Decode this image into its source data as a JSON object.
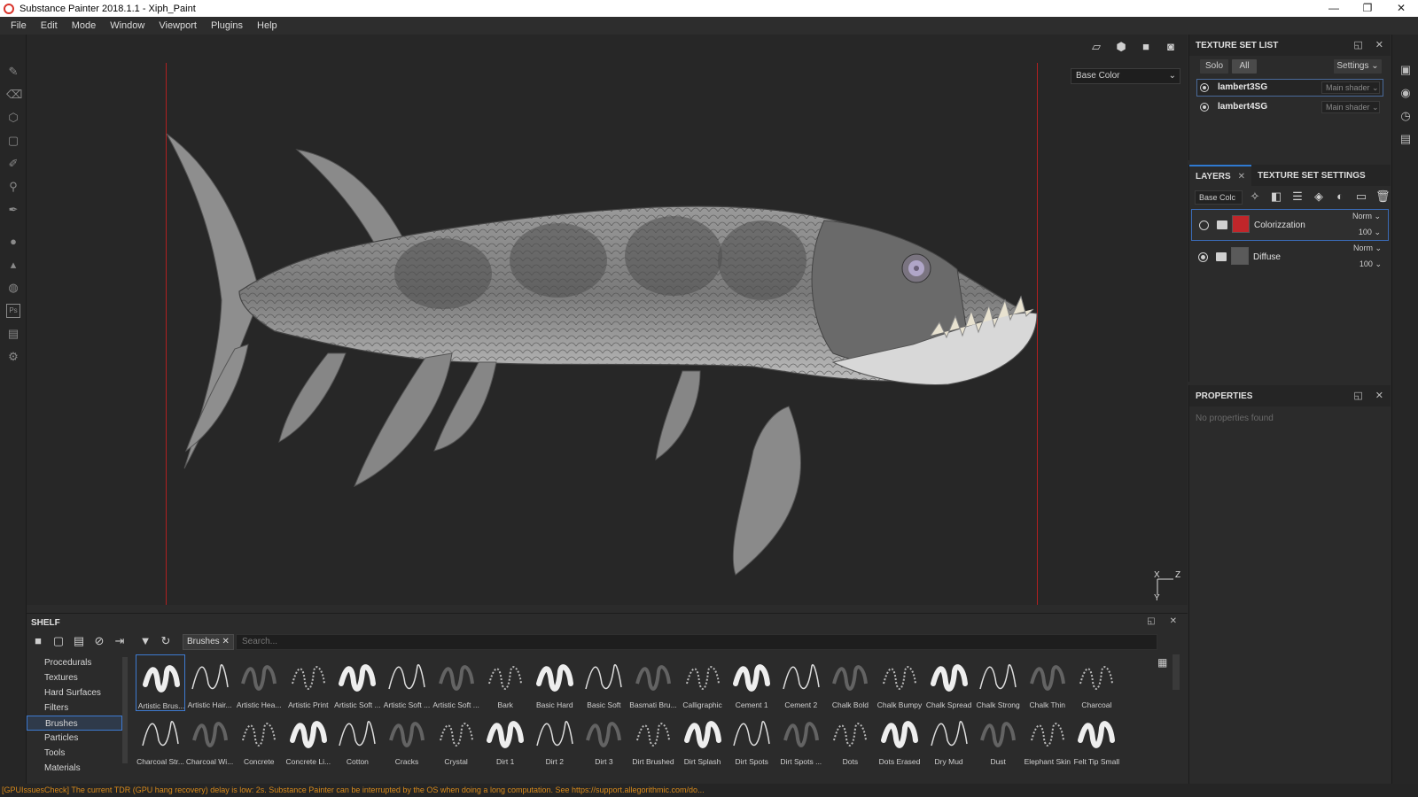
{
  "window": {
    "title": "Substance Painter 2018.1.1 - Xiph_Paint",
    "controls": [
      "—",
      "❐",
      "✕"
    ]
  },
  "menu": [
    "File",
    "Edit",
    "Mode",
    "Window",
    "Viewport",
    "Plugins",
    "Help"
  ],
  "left_tools": [
    "paint-brush-icon",
    "eraser-icon",
    "projection-icon",
    "geometry-mask-icon",
    "smudge-icon",
    "clone-icon",
    "color-picker-icon",
    "material-ball-icon",
    "bell-icon",
    "sphere-icon",
    "photoshop-icon",
    "export-icon",
    "settings-icon"
  ],
  "viewport": {
    "channel": "Base Color",
    "toolbar_icons": [
      "frame-icon",
      "cube-icon",
      "camera-icon",
      "screenshot-icon"
    ],
    "axis": {
      "x": "X",
      "z": "Z",
      "y": "Y"
    }
  },
  "texture_set_list": {
    "header": "TEXTURE SET LIST",
    "solo_label": "Solo",
    "all_label": "All",
    "settings_label": "Settings",
    "sets": [
      {
        "name": "lambert3SG",
        "shader": "Main shader",
        "active": true
      },
      {
        "name": "lambert4SG",
        "shader": "Main shader",
        "active": false
      }
    ]
  },
  "layers_panel": {
    "tab_layers": "LAYERS",
    "tab_settings": "TEXTURE SET SETTINGS",
    "channel": "Base Colc",
    "layers": [
      {
        "name": "Colorizzation",
        "blend": "Norm",
        "opacity": "100",
        "visible": false,
        "active": true,
        "thumb_color": "#c0262a"
      },
      {
        "name": "Diffuse",
        "blend": "Norm",
        "opacity": "100",
        "visible": true,
        "active": false,
        "thumb_color": "#5a5a5a"
      }
    ]
  },
  "properties": {
    "header": "PROPERTIES",
    "empty_text": "No properties found"
  },
  "shelf": {
    "header": "SHELF",
    "filter_chip": "Brushes",
    "search_placeholder": "Search...",
    "categories": [
      "Procedurals",
      "Textures",
      "Hard Surfaces",
      "Filters",
      "Brushes",
      "Particles",
      "Tools",
      "Materials"
    ],
    "active_category": "Brushes",
    "items_row1": [
      "Artistic Brus...",
      "Artistic Hair...",
      "Artistic Hea...",
      "Artistic Print",
      "Artistic Soft ...",
      "Artistic Soft ...",
      "Artistic Soft ...",
      "Bark",
      "Basic Hard",
      "Basic Soft",
      "Basmati Bru...",
      "Calligraphic",
      "Cement 1",
      "Cement 2",
      "Chalk Bold",
      "Chalk Bumpy",
      "Chalk Spread",
      "Chalk Strong",
      "Chalk Thin",
      "Charcoal"
    ],
    "items_row2": [
      "Charcoal Str...",
      "Charcoal Wi...",
      "Concrete",
      "Concrete Li...",
      "Cotton",
      "Cracks",
      "Crystal",
      "Dirt 1",
      "Dirt 2",
      "Dirt 3",
      "Dirt Brushed",
      "Dirt Splash",
      "Dirt Spots",
      "Dirt Spots ...",
      "Dots",
      "Dots Erased",
      "Dry Mud",
      "Dust",
      "Elephant Skin",
      "Felt Tip Small"
    ]
  },
  "status": "[GPUIssuesCheck] The current TDR (GPU hang recovery) delay is low: 2s. Substance Painter can be interrupted by the OS when doing a long computation. See https://support.allegorithmic.com/do..."
}
